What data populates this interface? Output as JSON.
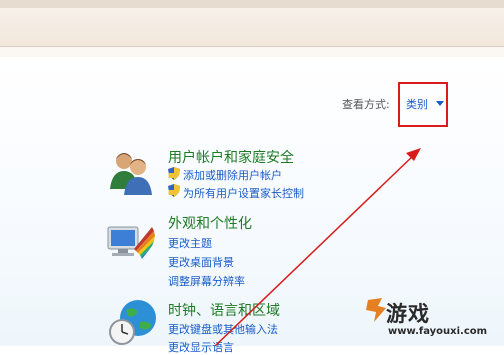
{
  "header": {
    "view_by_label": "查看方式:",
    "view_by_value": "类别"
  },
  "categories": [
    {
      "title": "用户帐户和家庭安全",
      "links": [
        "添加或删除用户帐户",
        "为所有用户设置家长控制"
      ]
    },
    {
      "title": "外观和个性化",
      "links": [
        "更改主题",
        "更改桌面背景",
        "调整屏幕分辨率"
      ]
    },
    {
      "title": "时钟、语言和区域",
      "links": [
        "更改键盘或其他输入法",
        "更改显示语言"
      ]
    }
  ],
  "watermark": {
    "brand": "游戏",
    "url": "www.fayouxi.com"
  },
  "colors": {
    "link": "#1a5cc8",
    "category_title": "#1e7a24",
    "annotation": "#d91b1b"
  }
}
